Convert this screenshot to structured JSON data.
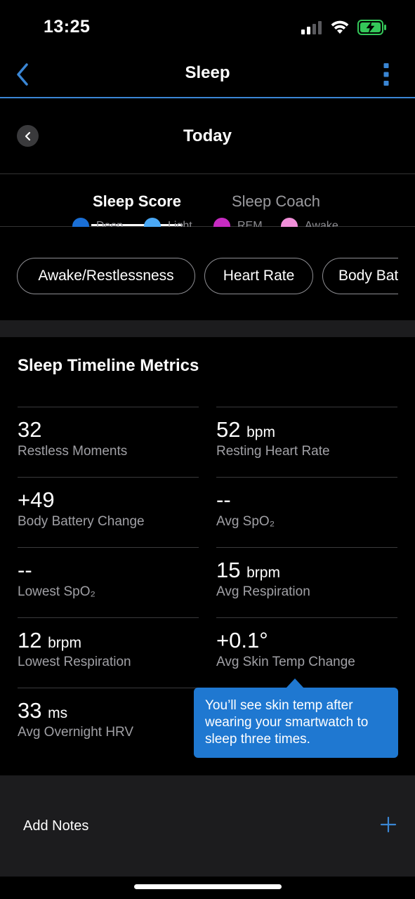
{
  "status_bar": {
    "time": "13:25",
    "icons": [
      "signal-icon",
      "wifi-icon",
      "battery-charging-icon"
    ]
  },
  "nav": {
    "title": "Sleep",
    "back_icon": "chevron-left-icon",
    "menu_icon": "more-vertical-icon"
  },
  "date": {
    "title": "Today",
    "prev_icon": "chevron-left-icon"
  },
  "tabs": [
    {
      "label": "Sleep Score",
      "active": true
    },
    {
      "label": "Sleep Coach",
      "active": false
    }
  ],
  "legend": [
    {
      "label": "Deep",
      "color": "#1a6fd6"
    },
    {
      "label": "Light",
      "color": "#4aa8f5"
    },
    {
      "label": "REM",
      "color": "#c72bc2"
    },
    {
      "label": "Awake",
      "color": "#f08fd8"
    }
  ],
  "chips": [
    "Awake/Restlessness",
    "Heart Rate",
    "Body Battery"
  ],
  "metrics": {
    "title": "Sleep Timeline Metrics",
    "items": [
      {
        "value": "32",
        "unit": "",
        "label": "Restless Moments"
      },
      {
        "value": "52",
        "unit": "bpm",
        "label": "Resting Heart Rate"
      },
      {
        "value": "+49",
        "unit": "",
        "label": "Body Battery Change"
      },
      {
        "value": "--",
        "unit": "",
        "label": "Avg SpO₂"
      },
      {
        "value": "--",
        "unit": "",
        "label": "Lowest SpO₂"
      },
      {
        "value": "15",
        "unit": "brpm",
        "label": "Avg Respiration"
      },
      {
        "value": "12",
        "unit": "brpm",
        "label": "Lowest Respiration"
      },
      {
        "value": "+0.1°",
        "unit": "",
        "label": "Avg Skin Temp Change"
      },
      {
        "value": "33",
        "unit": "ms",
        "label": "Avg Overnight HRV"
      }
    ]
  },
  "tooltip": {
    "text": "You’ll see skin temp after wearing your smartwatch to sleep three times."
  },
  "notes": {
    "label": "Add Notes",
    "add_icon": "plus-icon"
  },
  "colors": {
    "accent": "#3a86d4",
    "tooltip": "#1f78d1",
    "background": "#000000",
    "card": "#1c1c1e"
  }
}
